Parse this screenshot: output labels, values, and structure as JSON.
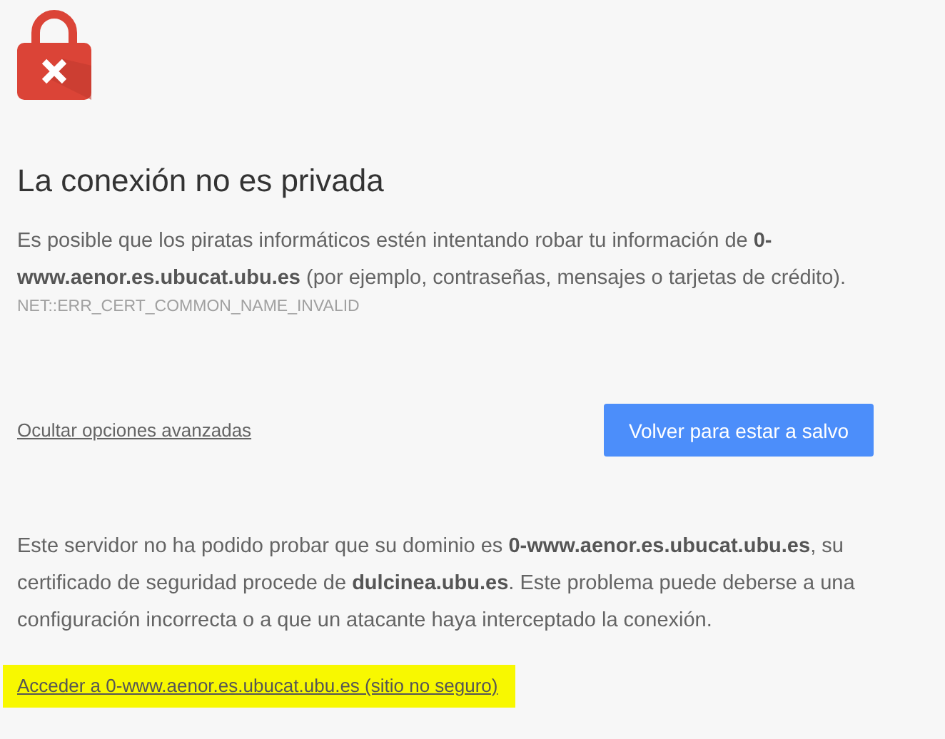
{
  "heading": "La conexión no es privada",
  "intro": "Es posible que los piratas informáticos estén intentando robar tu información de **0-www.aenor.es.ubucat.ubu.es** (por ejemplo, contraseñas, mensajes o tarjetas de crédito).",
  "error_code": "NET::ERR_CERT_COMMON_NAME_INVALID",
  "advanced_link": "Ocultar opciones avanzadas",
  "back_button": "Volver para estar a salvo",
  "details": "Este servidor no ha podido probar que su dominio es **0-www.aenor.es.ubucat.ubu.es**, su certificado de seguridad procede de **dulcinea.ubu.es**. Este problema puede deberse a una configuración incorrecta o a que un atacante haya interceptado la conexión.",
  "proceed_link": {
    "text": "Acceder a 0-www.aenor.es.ubucat.ubu.es (sitio no seguro)",
    "highlighted": true
  }
}
